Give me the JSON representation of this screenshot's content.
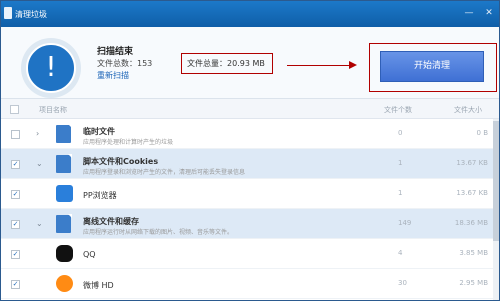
{
  "window": {
    "title": "清理垃圾",
    "min_symbol": "—",
    "close_symbol": "✕"
  },
  "summary": {
    "status": "扫描结束",
    "file_count_label": "文件总数：",
    "file_count": "153",
    "rescan": "重新扫描",
    "total_label": "文件总量：",
    "total_value": "20.93 MB",
    "start_button": "开始清理",
    "alert_symbol": "!"
  },
  "table": {
    "headers": {
      "name": "项目名称",
      "count": "文件个数",
      "size": "文件大小"
    },
    "rows": [
      {
        "title": "临时文件",
        "desc": "应用程序处理和计算时产生的垃圾",
        "count": "0",
        "size": "0 B",
        "checked": false,
        "expanded": false
      },
      {
        "title": "脚本文件和Cookies",
        "desc": "应用程序登录和浏览时产生的文件，清理后可能丢失登录信息",
        "count": "1",
        "size": "13.67 KB",
        "checked": true,
        "expanded": true
      },
      {
        "title": "PP浏览器",
        "count": "1",
        "size": "13.67 KB",
        "checked": true
      },
      {
        "title": "离线文件和缓存",
        "desc": "应用程序运行时从网络下载的图片、视频、音乐等文件。",
        "count": "149",
        "size": "18.36 MB",
        "checked": true,
        "expanded": true
      },
      {
        "title": "QQ",
        "count": "4",
        "size": "3.85 MB",
        "checked": true
      },
      {
        "title": "微博 HD",
        "count": "30",
        "size": "2.95 MB",
        "checked": true
      }
    ]
  }
}
